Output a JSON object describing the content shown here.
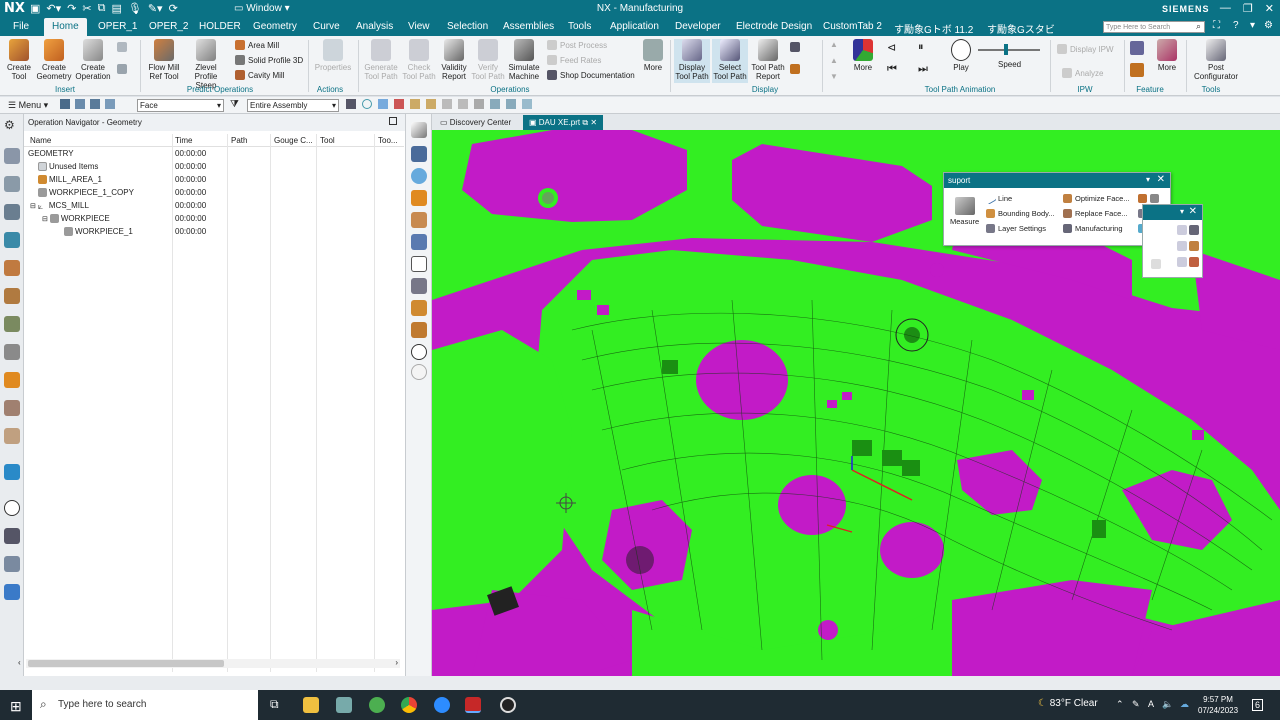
{
  "titlebar": {
    "app_short": "NX",
    "window_menu": "Window",
    "title": "NX - Manufacturing",
    "brand": "SIEMENS"
  },
  "menubar": {
    "tabs": [
      "File",
      "Home",
      "OPER_1",
      "OPER_2",
      "HOLDER",
      "Geometry",
      "Curve",
      "Analysis",
      "View",
      "Selection",
      "Assemblies",
      "Tools",
      "Application",
      "Developer",
      "Electrode Design",
      "CustomTab 2",
      "す勵象Gトボ 11.2",
      "す勵象Gスタビ"
    ],
    "active_tab": "Home",
    "search_placeholder": "Type Here to Search"
  },
  "ribbon": {
    "insert": {
      "label": "Insert",
      "buttons": [
        "Create Tool",
        "Create Geometry",
        "Create Operation"
      ]
    },
    "predict": {
      "label": "Predict Operations",
      "buttons": [
        "Flow Mill Ref Tool",
        "Zlevel Profile Steep"
      ],
      "small": [
        "Area Mill",
        "Solid Profile 3D",
        "Cavity Mill"
      ]
    },
    "actions": {
      "label": "Actions",
      "buttons": [
        "Properties"
      ]
    },
    "operations": {
      "label": "Operations",
      "buttons": [
        "Generate Tool Path",
        "Check Tool Path",
        "Validity Report",
        "Verify Tool Path",
        "Simulate Machine"
      ],
      "small": [
        "Post Process",
        "Feed Rates",
        "Shop Documentation"
      ],
      "more": "More"
    },
    "display": {
      "label": "Display",
      "buttons": [
        "Display Tool Path",
        "Select Tool Path",
        "Tool Path Report"
      ]
    },
    "animation": {
      "label": "Tool Path Animation",
      "more": "More",
      "play": "Play",
      "speed": "Speed"
    },
    "ipw": {
      "label": "IPW",
      "small": [
        "Display IPW",
        "Analyze"
      ]
    },
    "feature": {
      "label": "Feature",
      "more": "More"
    },
    "tools": {
      "label": "Tools",
      "post": "Post Configurator"
    }
  },
  "toolbar2": {
    "menu": "Menu",
    "filter": "Face",
    "scope": "Entire Assembly"
  },
  "navigator": {
    "title": "Operation Navigator - Geometry",
    "columns": [
      "Name",
      "Time",
      "Path",
      "Gouge C...",
      "Tool",
      "Too..."
    ],
    "rows": [
      {
        "name": "GEOMETRY",
        "time": "00:00:00"
      },
      {
        "name": "Unused Items",
        "time": "00:00:00"
      },
      {
        "name": "MILL_AREA_1",
        "time": "00:00:00"
      },
      {
        "name": "WORKPIECE_1_COPY",
        "time": "00:00:00"
      },
      {
        "name": "MCS_MILL",
        "time": "00:00:00"
      },
      {
        "name": "WORKPIECE",
        "time": "00:00:00"
      },
      {
        "name": "WORKPIECE_1",
        "time": "00:00:00"
      }
    ]
  },
  "doc_tabs": [
    "Discovery Center",
    "DAU XE.prt"
  ],
  "suport_panel": {
    "title": "suport",
    "measure": "Measure",
    "items": [
      "Line",
      "Bounding Body...",
      "Layer Settings",
      "Optimize Face...",
      "Replace Face...",
      "Manufacturing"
    ]
  },
  "taskbar": {
    "search_placeholder": "Type here to search",
    "weather": "83°F  Clear",
    "time": "9:57 PM",
    "date": "07/24/2023",
    "notifications": "6"
  },
  "colors": {
    "accent": "#0b7285",
    "model_green": "#33ee22",
    "model_magenta": "#c21bc7"
  }
}
